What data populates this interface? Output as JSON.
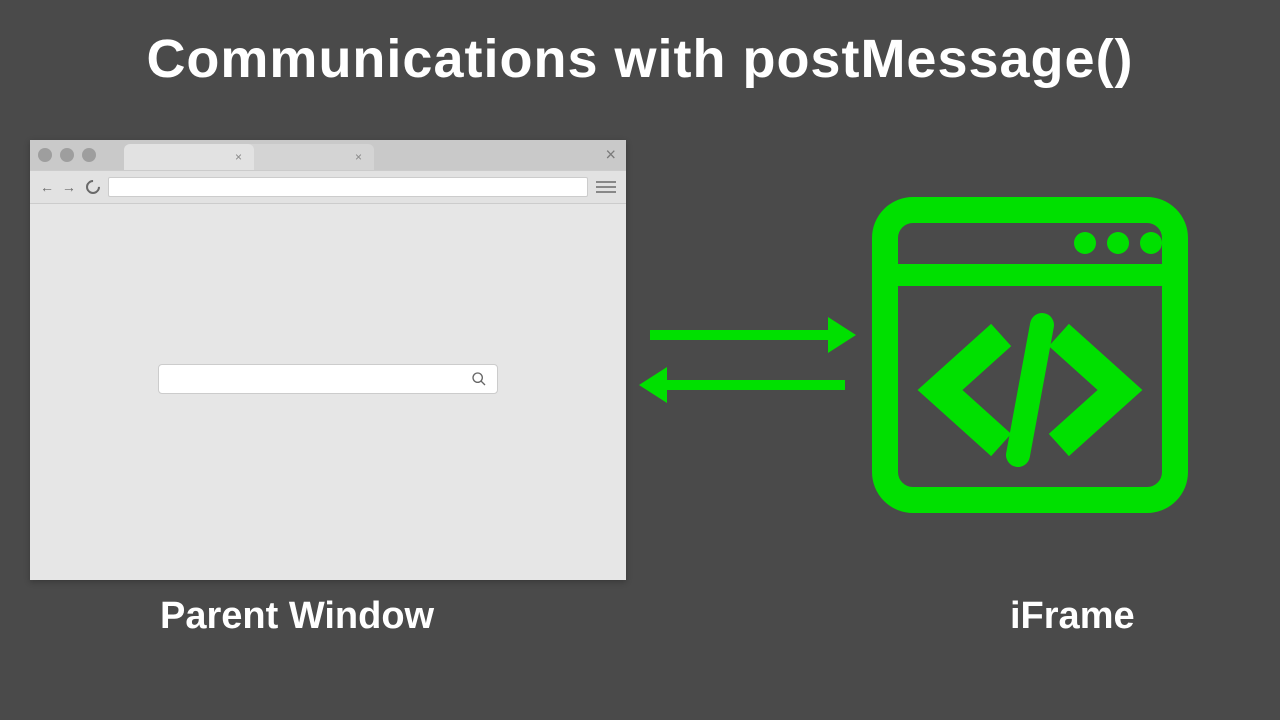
{
  "title": "Communications with postMessage()",
  "labels": {
    "parent": "Parent Window",
    "iframe": "iFrame"
  },
  "browser": {
    "tab_close": "×",
    "window_close": "×"
  },
  "colors": {
    "accent": "#00e000",
    "background": "#4a4a4a",
    "browser_chrome": "#c9c9c9",
    "browser_body": "#e6e6e6"
  },
  "icons": {
    "search": "search-icon",
    "code": "code-icon",
    "arrow_right": "arrow-right-icon",
    "arrow_left": "arrow-left-icon"
  }
}
